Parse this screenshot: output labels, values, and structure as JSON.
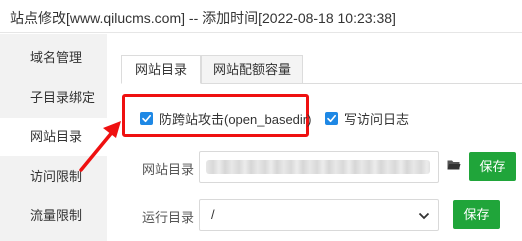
{
  "window": {
    "title": "站点修改[www.qilucms.com] -- 添加时间[2022-08-18 10:23:38]"
  },
  "sidebar": {
    "items": [
      {
        "label": "域名管理"
      },
      {
        "label": "子目录绑定"
      },
      {
        "label": "网站目录"
      },
      {
        "label": "访问限制"
      },
      {
        "label": "流量限制"
      }
    ]
  },
  "tabs": [
    {
      "label": "网站目录"
    },
    {
      "label": "网站配额容量"
    }
  ],
  "options": {
    "anti_cross": {
      "label": "防跨站攻击(open_basedir)",
      "checked": true
    },
    "access_log": {
      "label": "写访问日志",
      "checked": true
    }
  },
  "site_dir": {
    "label": "网站目录",
    "value": "",
    "save_label": "保存"
  },
  "run_dir": {
    "label": "运行目录",
    "value": "/",
    "save_label": "保存"
  },
  "colors": {
    "accent": "#1e88e5",
    "save_button": "#20a53a",
    "highlight": "#ef1010"
  },
  "icons": {
    "folder": "folder-icon",
    "chevron": "chevron-down-icon",
    "check": "check-icon",
    "arrow": "arrow-annotation"
  }
}
